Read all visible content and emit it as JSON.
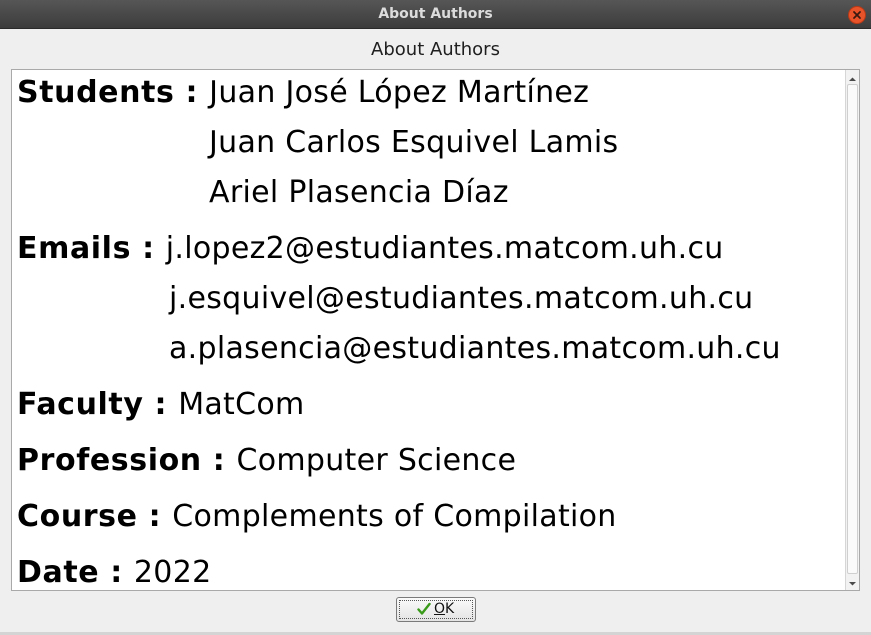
{
  "window": {
    "title": "About Authors"
  },
  "dialog": {
    "heading": "About Authors"
  },
  "info": {
    "students_label": "Students :",
    "students": [
      "Juan José López Martínez",
      "Juan Carlos Esquivel Lamis",
      "Ariel Plasencia Díaz"
    ],
    "emails_label": "Emails :",
    "emails": [
      "j.lopez2@estudiantes.matcom.uh.cu",
      "j.esquivel@estudiantes.matcom.uh.cu",
      "a.plasencia@estudiantes.matcom.uh.cu"
    ],
    "faculty_label": "Faculty :",
    "faculty": "MatCom",
    "profession_label": "Profession :",
    "profession": "Computer Science",
    "course_label": "Course :",
    "course": "Complements of Compilation",
    "date_label": "Date :",
    "date": "2022"
  },
  "buttons": {
    "ok_first": "O",
    "ok_rest": "K"
  },
  "icons": {
    "close": "close-icon",
    "ok": "checkmark-icon",
    "scroll_up": "arrow-up-icon",
    "scroll_down": "arrow-down-icon"
  },
  "colors": {
    "close": "#e9532a",
    "check": "#3a9a1a"
  }
}
